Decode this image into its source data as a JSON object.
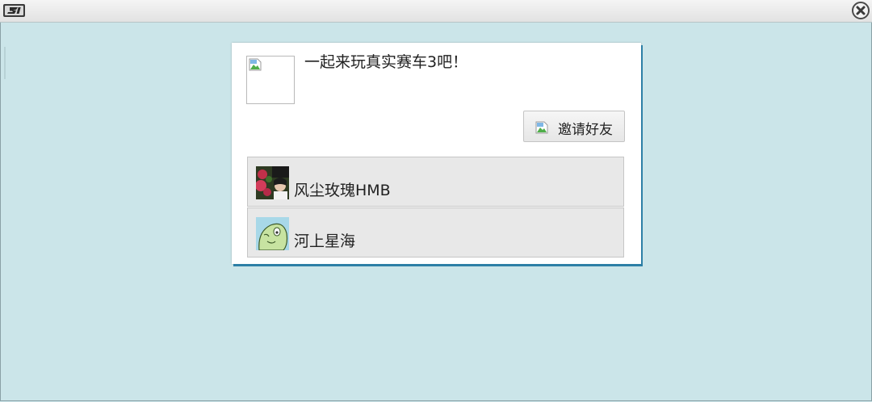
{
  "titlebar": {
    "logo_icon": "game-3-logo-icon",
    "close_icon": "close-circle-icon"
  },
  "dialog": {
    "message": "一起来玩真实赛车3吧！",
    "invite_button_label": "邀请好友",
    "friends": [
      {
        "name": "风尘玫瑰HMB",
        "avatar": "photo-avatar"
      },
      {
        "name": "河上星海",
        "avatar": "cartoon-avatar"
      }
    ]
  },
  "colors": {
    "background": "#cbe5e9",
    "dialog_shadow": "#2d7fa6",
    "list_item_bg": "#e8e8e8"
  }
}
